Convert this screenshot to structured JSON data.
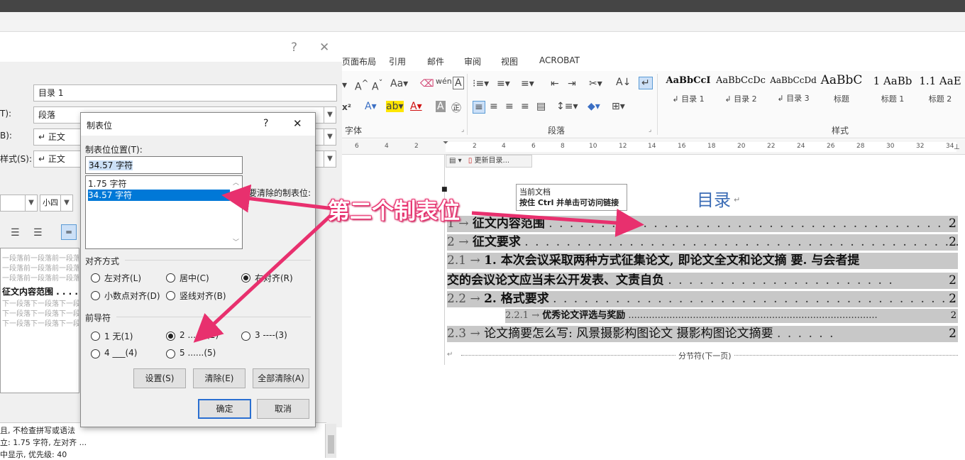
{
  "style_dialog": {
    "help_glyph": "?",
    "close_glyph": "✕",
    "name_value": "目录 1",
    "type_label_fragment": "T):",
    "type_value": "段落",
    "based_label_fragment": "B):",
    "based_value": "↵ 正文",
    "next_label_fragment": "样式(S):",
    "next_value": "↵ 正文",
    "size_value": "小四",
    "preview_before": "一段落前一段落前一段落前一段落前一段落前一段落前一段落前一段落前一段落前",
    "preview_sample": "征文内容范围 . . . . .",
    "preview_after": "下一段落下一段落下一段落下一段落下一段落下一段落下一段落下一段落下一段落",
    "desc_line1": "且, 不检查拼写或语法",
    "desc_line2": "立: 1.75 字符, 左对齐 ...",
    "desc_line3": "中显示, 优先级: 40"
  },
  "ribbon": {
    "tabs": [
      "页面布局",
      "引用",
      "邮件",
      "审阅",
      "视图",
      "ACROBAT"
    ],
    "groups": {
      "font": "字体",
      "paragraph": "段落",
      "styles": "样式"
    },
    "styles": [
      {
        "sample": "AaBbCcI",
        "name": "↲ 目录 1"
      },
      {
        "sample": "AaBbCcDc",
        "name": "↲ 目录 2"
      },
      {
        "sample": "AaBbCcDd",
        "name": "↲ 目录 3"
      },
      {
        "sample": "AaBbC",
        "name": "标题"
      },
      {
        "sample": "1 AaBb",
        "name": "标题 1"
      },
      {
        "sample": "1.1 AaE",
        "name": "标题 2"
      }
    ]
  },
  "ruler": {
    "ticks": [
      "6",
      "4",
      "2",
      "",
      "2",
      "4",
      "6",
      "8",
      "10",
      "12",
      "14",
      "16",
      "18",
      "20",
      "22",
      "24",
      "26",
      "28",
      "30",
      "32",
      "34"
    ]
  },
  "document": {
    "toc_toolbar_label": "更新目录...",
    "tooltip_line1": "当前文档",
    "tooltip_line2": "按住 Ctrl 并单击可访问链接",
    "heading": "目录",
    "entries": [
      {
        "num": "1 →",
        "text": "征文内容范围",
        "page": "2"
      },
      {
        "num": "2 →",
        "text": "征文要求",
        "page": "2"
      },
      {
        "num": "2.1 →",
        "text": "1. 本次会议采取两种方式征集论文, 即论文全文和论文摘 要. 与会者提",
        "page": ""
      },
      {
        "num": "",
        "text": "交的会议论文应当未公开发表、文责自负",
        "page": "2"
      },
      {
        "num": "2.2 →",
        "text": "2. 格式要求",
        "page": "2"
      },
      {
        "num": "2.2.1 →",
        "text": "优秀论文评选与奖励",
        "page": "2"
      },
      {
        "num": "2.3 →",
        "text": "论文摘要怎么写: 风景摄影构图论文 摄影构图论文摘要",
        "page": "2"
      }
    ],
    "section_break": "分节符(下一页)"
  },
  "tab_dialog": {
    "title": "制表位",
    "help_glyph": "?",
    "close_glyph": "✕",
    "position_label": "制表位位置(T):",
    "position_value": "34.57 字符",
    "list_items": [
      "1.75 字符",
      "34.57 字符"
    ],
    "clear_label": "要清除的制表位:",
    "align_label": "对齐方式",
    "align_options": [
      "左对齐(L)",
      "居中(C)",
      "右对齐(R)",
      "小数点对齐(D)",
      "竖线对齐(B)"
    ],
    "align_selected": "右对齐(R)",
    "leader_label": "前导符",
    "leader_options": [
      "1 无(1)",
      "2 .......(2)",
      "3 ----(3)",
      "4 ___(4)",
      "5 ......(5)"
    ],
    "leader_selected": "2 .......(2)",
    "btn_set": "设置(S)",
    "btn_clear": "清除(E)",
    "btn_clear_all": "全部清除(A)",
    "btn_ok": "确定",
    "btn_cancel": "取消"
  },
  "annotation": {
    "text": "第二个制表位",
    "color": "#e8306e"
  }
}
